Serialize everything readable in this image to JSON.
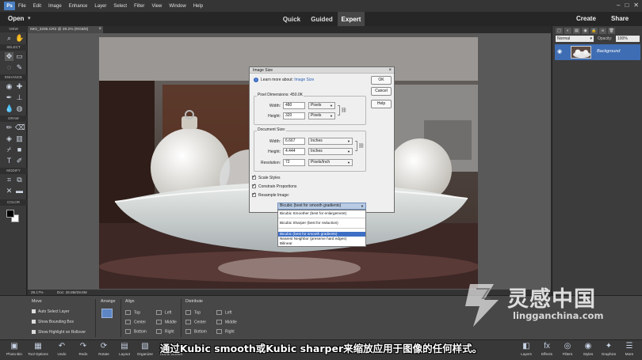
{
  "menubar": {
    "logo": "Ps",
    "items": [
      "File",
      "Edit",
      "Image",
      "Enhance",
      "Layer",
      "Select",
      "Filter",
      "View",
      "Window",
      "Help"
    ]
  },
  "modebar": {
    "open": "Open",
    "tabs": [
      "Quick",
      "Guided",
      "Expert"
    ],
    "active_tab": "Expert",
    "create": "Create",
    "share": "Share"
  },
  "toolbox": {
    "sections": [
      "VIEW",
      "SELECT",
      "ENHANCE",
      "DRAW",
      "MODIFY",
      "COLOR"
    ]
  },
  "document": {
    "tab_title": "IMG_3285.CR2 @ 29.2% (RGB/8)",
    "zoom": "29.17%",
    "doc_size": "Doc: 28.8M/28.8M"
  },
  "layers": {
    "blend_mode": "Normal",
    "opacity_label": "Opacity:",
    "opacity_value": "100%",
    "layer_name": "Background"
  },
  "dialog": {
    "title": "Image Size",
    "learn_more_prefix": "Learn more about:",
    "learn_more_link": "Image Size",
    "buttons": {
      "ok": "OK",
      "cancel": "Cancel",
      "help": "Help"
    },
    "pixel_dimensions_label": "Pixel Dimensions:",
    "pixel_dimensions_value": "450.0K",
    "width_label": "Width:",
    "height_label": "Height:",
    "pixel_width": "480",
    "pixel_height": "320",
    "pixel_unit": "Pixels",
    "document_size_label": "Document Size:",
    "doc_width": "6.667",
    "doc_height": "4.444",
    "doc_unit": "Inches",
    "resolution_label": "Resolution:",
    "resolution": "72",
    "resolution_unit": "Pixels/Inch",
    "scale_styles": "Scale Styles",
    "constrain": "Constrain Proportions",
    "resample": "Resample Image:",
    "resample_value": "Bicubic (best for smooth gradients)"
  },
  "dropdown": {
    "options": [
      "Bicubic Smoother (best for enlargement)",
      "Bicubic Sharper (best for reduction)",
      "Bicubic (best for smooth gradients)",
      "Nearest Neighbor (preserve hard edges)",
      "Bilinear"
    ],
    "selected_index": 2
  },
  "tool_options": {
    "move_header": "Move",
    "arrange_header": "Arrange",
    "align_header": "Align",
    "distribute_header": "Distribute",
    "checks": [
      "Auto Select Layer",
      "Show Bounding Box",
      "Show Highlight on Rollover"
    ],
    "align_labels": [
      "Top",
      "Center",
      "Bottom",
      "Left",
      "Middle",
      "Right"
    ]
  },
  "bottom_bar": {
    "left": [
      {
        "icon": "photo-bin-icon",
        "label": "Photo Bin"
      },
      {
        "icon": "tool-options-icon",
        "label": "Tool Options"
      },
      {
        "icon": "undo-icon",
        "label": "Undo"
      },
      {
        "icon": "redo-icon",
        "label": "Redo"
      },
      {
        "icon": "rotate-icon",
        "label": "Rotate"
      },
      {
        "icon": "layout-icon",
        "label": "Layout"
      },
      {
        "icon": "organizer-icon",
        "label": "Organizer"
      },
      {
        "icon": "home-screen-icon",
        "label": "Home Screen"
      }
    ],
    "right": [
      {
        "icon": "layers-icon",
        "label": "Layers"
      },
      {
        "icon": "effects-icon",
        "label": "Effects"
      },
      {
        "icon": "filters-icon",
        "label": "Filters"
      },
      {
        "icon": "styles-icon",
        "label": "Styles"
      },
      {
        "icon": "graphics-icon",
        "label": "Graphics"
      },
      {
        "icon": "more-icon",
        "label": "More"
      }
    ]
  },
  "subtitle": "通过Kubic smooth或Kubic sharper来缩放应用于图像的任何样式。",
  "watermark": {
    "cn": "灵感中国",
    "url": "lingganchina.com"
  },
  "colors": {
    "accent": "#3d6fc5",
    "panel": "#3c3c3c",
    "background": "#2b2b2b"
  }
}
